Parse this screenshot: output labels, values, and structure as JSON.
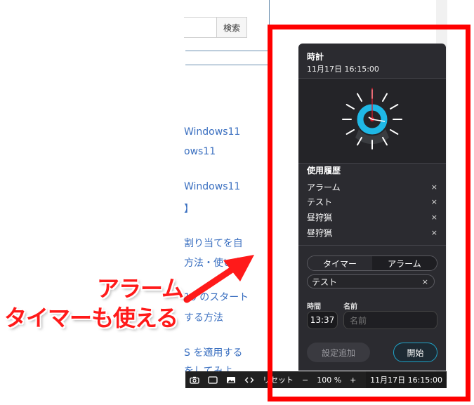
{
  "background_page": {
    "search_button": "検索",
    "links": [
      "Windows11",
      "ows11",
      "Windows11",
      "】",
      "割り当てを自",
      "方法・使い方",
      "10 のスタート",
      "する方法",
      "S を適用する",
      "をしてみよ"
    ]
  },
  "annotation": {
    "line1": "アラーム",
    "line2": "タイマーも使える",
    "color": "#ff0000"
  },
  "panel": {
    "title": "時計",
    "datetime": "11月17日  16:15:00",
    "history_title": "使用履歴",
    "history": [
      {
        "label": "アラーム",
        "close": "×"
      },
      {
        "label": "テスト",
        "close": "×"
      },
      {
        "label": "昼狩猟",
        "close": "×"
      },
      {
        "label": "昼狩猟",
        "close": "×"
      }
    ],
    "tabs": {
      "timer": "タイマー",
      "alarm": "アラーム"
    },
    "name_value": "テスト",
    "name_clear": "×",
    "time_label": "時間",
    "name_label": "名前",
    "time_value": "13:37",
    "name_placeholder": "名前",
    "add_button": "設定追加",
    "start_button": "開始",
    "accent": "#1fb8e6"
  },
  "taskbar": {
    "icons": [
      "camera-icon",
      "window-icon",
      "image-icon",
      "code-icon"
    ],
    "reset": "リセット",
    "zoom_minus": "−",
    "zoom": "100 %",
    "zoom_plus": "+",
    "clock": "11月17日  16:15:00"
  }
}
